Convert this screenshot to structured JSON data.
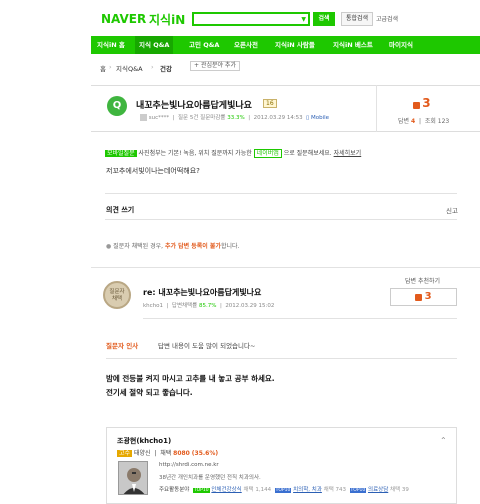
{
  "header": {
    "logo_naver": "NAVER",
    "logo_jisik": "지식iN",
    "search_placeholder": "",
    "search_button": "검색",
    "total_search": "통합검색",
    "advanced_search": "고급검색"
  },
  "nav": {
    "items": [
      "지식iN 홈",
      "지식 Q&A",
      "고민 Q&A",
      "오픈사전",
      "지식iN 사람들",
      "지식iN 베스트",
      "마이지식"
    ],
    "active_index": 1
  },
  "breadcrumb": {
    "home": "홈",
    "qna": "지식Q&A",
    "category": "건강",
    "add_interest": "+ 관심분야 추가"
  },
  "question": {
    "icon_letter": "Q",
    "title": "내꼬추는빛나요아름답게빛나요",
    "badge": "16",
    "author": "suc****",
    "meta_label": "질문 5건 질문마감률",
    "close_rate": "33.3%",
    "date": "2012.03.29 14:53",
    "mobile": "Mobile",
    "answers_label": "답변",
    "answers_count": "4",
    "views_label": "조회",
    "views_count": "123",
    "recommend": "3",
    "body": "저꼬추에서빛이나는데어떡해요?"
  },
  "mobile_banner": {
    "tag": "모바일질문",
    "text": "사진첨부는 기본! 녹음, 위치 질문까지 가능한",
    "tag2": "네이버앱",
    "text2": "으로 질문해보세요.",
    "link": "자세히보기"
  },
  "opinion": {
    "write": "의견 쓰기",
    "report": "신고"
  },
  "notice": {
    "prefix": "질문자 채택된 경우,",
    "highlight": "추가 답변 등록이 불가",
    "suffix": "합니다."
  },
  "answer": {
    "medal_line1": "질문자",
    "medal_line2": "채택",
    "title": "re: 내꼬추는빛나요아름답게빛나요",
    "author": "khcho1",
    "adopt_label": "답변채택률",
    "adopt_rate": "85.7%",
    "date": "2012.03.29 15:02",
    "recommend_label": "답변 추천하기",
    "recommend": "3",
    "thanks_label": "질문자 인사",
    "thanks_text": "답변 내용이 도움 많이 되었습니다~",
    "body_line1": "밤에 전등불 켜지 마시고 고추를 내 놓고 공부 하세요.",
    "body_line2": "전기세 절약 되고 좋습니다."
  },
  "profile": {
    "name": "조광현(khcho1)",
    "level_badge": "고수",
    "level": "태양신",
    "score_label": "채택",
    "score": "8080",
    "score_rate": "(35.6%)",
    "url": "http://shrdi.com.ne.kr",
    "desc": "38년간 개인치과를 운영했던 전직 치과의사.",
    "activity_label": "주요활동분야",
    "cat1_badge": "TOP10",
    "cat1": "인체건강상식",
    "cat1_count": "채택 1,144",
    "cat2_badge": "TOP10",
    "cat2": "치의학, 치과",
    "cat2_count": "채택 743",
    "cat3_badge": "TOP10",
    "cat3": "의료상담",
    "cat3_count": "채택 39"
  },
  "colors": {
    "brand_green": "#1ec800",
    "accent_orange": "#e25a1c"
  }
}
